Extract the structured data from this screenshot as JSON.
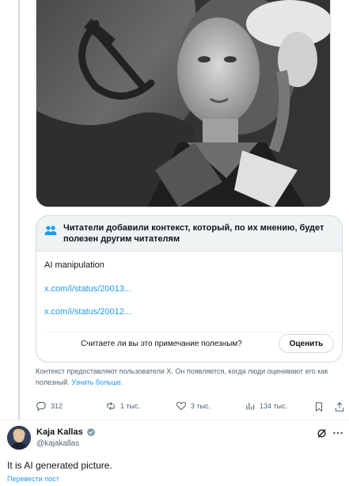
{
  "post": {
    "image": {
      "icon": "soviet-flag-portrait-photo",
      "colors": {
        "flag": "#5a5a5a",
        "background": "#2f2f2f"
      }
    }
  },
  "community_note": {
    "title": "Читатели добавили контекст, который, по их мнению, будет полезен другим читателям",
    "title_icon": "people-icon",
    "text": "AI manipulation",
    "links": [
      "x.com/i/status/20013...",
      "x.com/i/status/20012..."
    ],
    "question": "Считаете ли вы это примечание полезным?",
    "rate_label": "Оценить",
    "footer_text": "Контекст предоставляют пользователи X. Он появляется, когда люди оценивают его как полезный.",
    "footer_link": "Узнать больше."
  },
  "actions": {
    "replies": "312",
    "reposts": "1 тыс.",
    "likes": "3 тыс.",
    "views": "134 тыс."
  },
  "reply": {
    "name": "Kaja Kallas",
    "handle": "@kajakallas",
    "text": "It is AI generated picture.",
    "translate_label": "Перевести пост"
  },
  "colors": {
    "accent": "#1d9bf0",
    "muted": "#536471",
    "verified": "#829aab"
  }
}
